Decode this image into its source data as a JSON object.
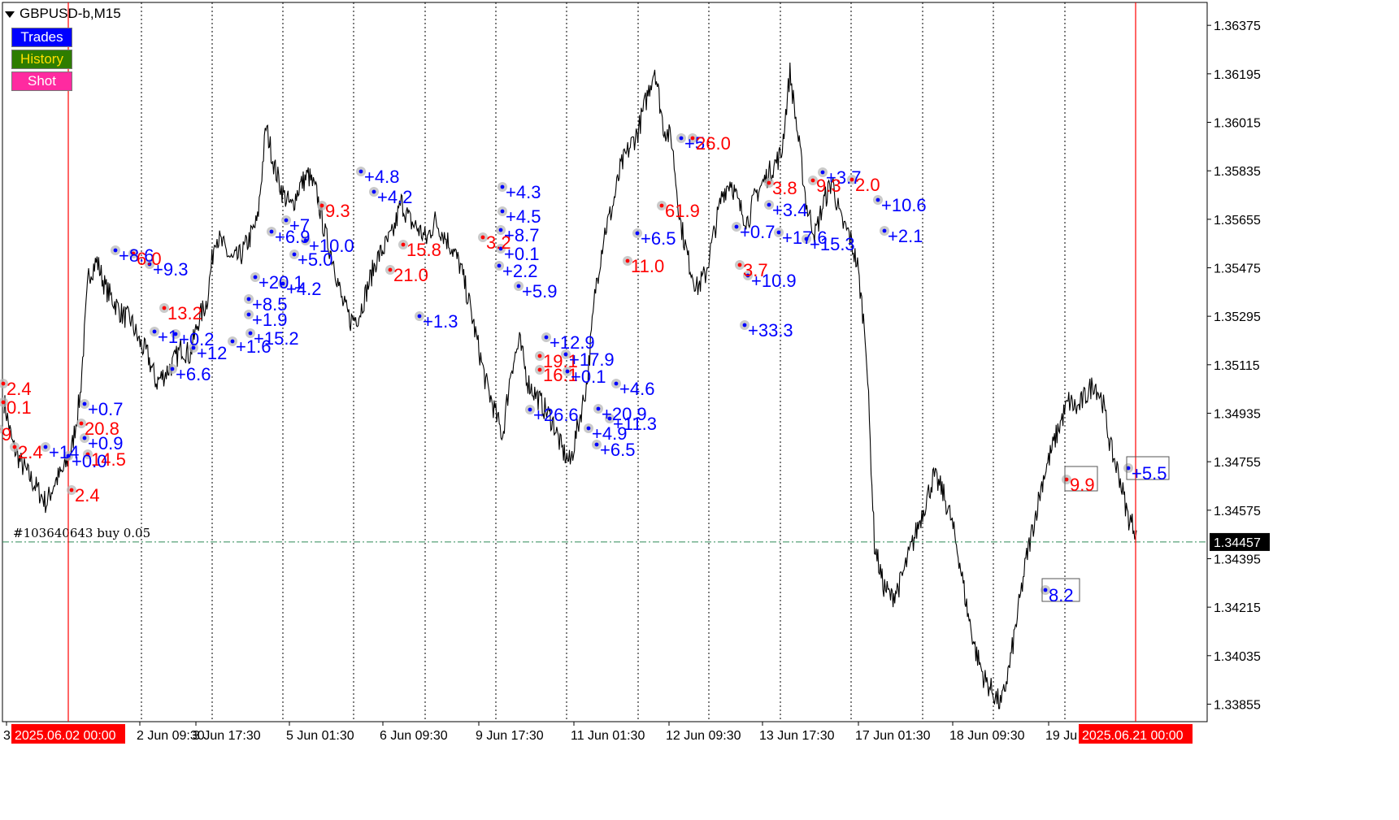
{
  "window": {
    "symbol_title": "GBPUSD-b,M15"
  },
  "buttons": {
    "trades": "Trades",
    "history": "History",
    "shot": "Shot"
  },
  "order_line": {
    "label": "#103640643 buy 0.05",
    "price": "1.34457"
  },
  "colors": {
    "background": "#ffffff",
    "price_line": "#000000",
    "profit_label": "#0000ff",
    "loss_label": "#ff0000",
    "vline": "#ff0000",
    "order_line": "#2e8b57",
    "date_badge_bg": "#ff0000",
    "date_badge_text": "#ffffff",
    "current_price_bg": "#000000",
    "current_price_text": "#ffffff"
  },
  "markers": {
    "start_date": "2025.06.02 00:00",
    "end_date": "2025.06.21 00:00"
  },
  "chart_data": {
    "type": "line",
    "title": "GBPUSD-b,M15",
    "timeframe": "M15",
    "ylim": [
      1.3379,
      1.3646
    ],
    "grid": "vertical dotted at session separators",
    "yticks": [
      "1.36375",
      "1.36195",
      "1.36015",
      "1.35835",
      "1.35655",
      "1.35475",
      "1.35295",
      "1.35115",
      "1.34935",
      "1.34755",
      "1.34575",
      "1.34395",
      "1.34215",
      "1.34035",
      "1.33855"
    ],
    "xticks": [
      "3",
      "2 Jun 09:30",
      "3 Jun 17:30",
      "5 Jun 01:30",
      "6 Jun 09:30",
      "9 Jun 17:30",
      "11 Jun 01:30",
      "12 Jun 09:30",
      "13 Jun 17:30",
      "17 Jun 01:30",
      "18 Jun 09:30",
      "19 Ju"
    ],
    "current_price": 1.34457,
    "series": [
      {
        "values": [
          1.3498,
          1.3482,
          1.3475,
          1.347,
          1.3465,
          1.346,
          1.3468,
          1.3472,
          1.348,
          1.35,
          1.3545,
          1.355,
          1.354,
          1.3535,
          1.353,
          1.3528,
          1.352,
          1.3515,
          1.3505,
          1.3508,
          1.3512,
          1.3518,
          1.3515,
          1.3528,
          1.3535,
          1.356,
          1.3555,
          1.355,
          1.3552,
          1.3558,
          1.3565,
          1.36,
          1.3585,
          1.3575,
          1.357,
          1.3578,
          1.3582,
          1.3575,
          1.356,
          1.355,
          1.3535,
          1.3528,
          1.353,
          1.354,
          1.355,
          1.3555,
          1.356,
          1.3572,
          1.3565,
          1.3562,
          1.3558,
          1.3565,
          1.356,
          1.3555,
          1.3548,
          1.3535,
          1.352,
          1.3505,
          1.3495,
          1.3485,
          1.351,
          1.352,
          1.3505,
          1.35,
          1.3495,
          1.349,
          1.348,
          1.3475,
          1.349,
          1.3505,
          1.354,
          1.356,
          1.357,
          1.3585,
          1.3592,
          1.3598,
          1.361,
          1.3622,
          1.36,
          1.3595,
          1.3565,
          1.355,
          1.354,
          1.3545,
          1.356,
          1.3575,
          1.358,
          1.357,
          1.3565,
          1.3575,
          1.358,
          1.3585,
          1.359,
          1.362,
          1.3595,
          1.357,
          1.356,
          1.3572,
          1.358,
          1.3565,
          1.356,
          1.3548,
          1.352,
          1.3445,
          1.343,
          1.3425,
          1.343,
          1.344,
          1.345,
          1.346,
          1.347,
          1.3465,
          1.3455,
          1.344,
          1.342,
          1.3405,
          1.3395,
          1.339,
          1.3385,
          1.34,
          1.342,
          1.344,
          1.3455,
          1.347,
          1.348,
          1.349,
          1.3498,
          1.3495,
          1.35,
          1.3505,
          1.3498,
          1.348,
          1.347,
          1.3455,
          1.345
        ]
      }
    ],
    "trade_labels": [
      {
        "text": "2.4",
        "color": "red"
      },
      {
        "text": "0.1",
        "color": "red"
      },
      {
        "text": "9",
        "color": "red"
      },
      {
        "text": "+0.7",
        "color": "blue"
      },
      {
        "text": "20.8",
        "color": "red"
      },
      {
        "text": "+0.9",
        "color": "blue"
      },
      {
        "text": "14.5",
        "color": "red"
      },
      {
        "text": "2.4",
        "color": "red"
      },
      {
        "text": "2.4",
        "color": "red"
      },
      {
        "text": "+14",
        "color": "blue"
      },
      {
        "text": "+0.0",
        "color": "blue"
      },
      {
        "text": "+8.6",
        "color": "blue"
      },
      {
        "text": "6.0",
        "color": "red"
      },
      {
        "text": "+9.3",
        "color": "blue"
      },
      {
        "text": "13.2",
        "color": "red"
      },
      {
        "text": "+1",
        "color": "blue"
      },
      {
        "text": "+0.2",
        "color": "blue"
      },
      {
        "text": "+12",
        "color": "blue"
      },
      {
        "text": "+6.6",
        "color": "blue"
      },
      {
        "text": "+8.5",
        "color": "blue"
      },
      {
        "text": "+1.9",
        "color": "blue"
      },
      {
        "text": "+15.2",
        "color": "blue"
      },
      {
        "text": "+1.6",
        "color": "blue"
      },
      {
        "text": "+7",
        "color": "blue"
      },
      {
        "text": "+6.9",
        "color": "blue"
      },
      {
        "text": "+10.0",
        "color": "blue"
      },
      {
        "text": "+5.0",
        "color": "blue"
      },
      {
        "text": "+20.1",
        "color": "blue"
      },
      {
        "text": "+4.2",
        "color": "blue"
      },
      {
        "text": "9.3",
        "color": "red"
      },
      {
        "text": "+4.8",
        "color": "blue"
      },
      {
        "text": "+4.2",
        "color": "blue"
      },
      {
        "text": "15.8",
        "color": "red"
      },
      {
        "text": "21.0",
        "color": "red"
      },
      {
        "text": "+1.3",
        "color": "blue"
      },
      {
        "text": "+4.3",
        "color": "blue"
      },
      {
        "text": "+4.5",
        "color": "blue"
      },
      {
        "text": "+8.7",
        "color": "blue"
      },
      {
        "text": "3.2",
        "color": "red"
      },
      {
        "text": "+0.1",
        "color": "blue"
      },
      {
        "text": "+2.2",
        "color": "blue"
      },
      {
        "text": "+5.9",
        "color": "blue"
      },
      {
        "text": "+12.9",
        "color": "blue"
      },
      {
        "text": "19.1",
        "color": "red"
      },
      {
        "text": "+17.9",
        "color": "blue"
      },
      {
        "text": "16.1",
        "color": "red"
      },
      {
        "text": "+0.1",
        "color": "blue"
      },
      {
        "text": "+4.6",
        "color": "blue"
      },
      {
        "text": "+26.6",
        "color": "blue"
      },
      {
        "text": "+20.9",
        "color": "blue"
      },
      {
        "text": "+11.3",
        "color": "blue"
      },
      {
        "text": "+4.9",
        "color": "blue"
      },
      {
        "text": "+6.5",
        "color": "blue"
      },
      {
        "text": "+5",
        "color": "blue"
      },
      {
        "text": "26.0",
        "color": "red"
      },
      {
        "text": "61.9",
        "color": "red"
      },
      {
        "text": "+6.5",
        "color": "blue"
      },
      {
        "text": "11.0",
        "color": "red"
      },
      {
        "text": "3.8",
        "color": "red"
      },
      {
        "text": "+3.7",
        "color": "blue"
      },
      {
        "text": "9.3",
        "color": "red"
      },
      {
        "text": "2.0",
        "color": "red"
      },
      {
        "text": "+10.6",
        "color": "blue"
      },
      {
        "text": "+3.4",
        "color": "blue"
      },
      {
        "text": "+0.7",
        "color": "blue"
      },
      {
        "text": "+17.6",
        "color": "blue"
      },
      {
        "text": "+15.3",
        "color": "blue"
      },
      {
        "text": "+2.1",
        "color": "blue"
      },
      {
        "text": "3.7",
        "color": "red"
      },
      {
        "text": "+10.9",
        "color": "blue"
      },
      {
        "text": "+33.3",
        "color": "blue"
      },
      {
        "text": "9.9",
        "color": "red"
      },
      {
        "text": "+5.5",
        "color": "blue"
      },
      {
        "text": "8.2",
        "color": "blue"
      }
    ]
  }
}
